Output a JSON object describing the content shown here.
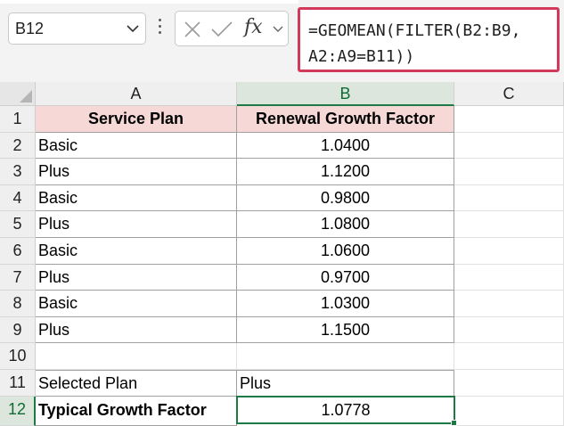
{
  "name_box": {
    "value": "B12",
    "dropdown_icon": "chevron-down-icon"
  },
  "formula_bar": {
    "cancel_icon": "close-icon",
    "enter_icon": "checkmark-icon",
    "function_label": "fx",
    "formula_line1": "=GEOMEAN(FILTER(B2:B9,",
    "formula_line2": "A2:A9=B11))",
    "highlight_color": "#d13a5a"
  },
  "columns": [
    "A",
    "B",
    "C"
  ],
  "rows": [
    "1",
    "2",
    "3",
    "4",
    "5",
    "6",
    "7",
    "8",
    "9",
    "10",
    "11",
    "12"
  ],
  "sheet": {
    "header": {
      "col_a": "Service Plan",
      "col_b": "Renewal Growth Factor",
      "fill": "#f6d9d7"
    },
    "data": [
      {
        "plan": "Basic",
        "factor": "1.0400"
      },
      {
        "plan": "Plus",
        "factor": "1.1200"
      },
      {
        "plan": "Basic",
        "factor": "0.9800"
      },
      {
        "plan": "Plus",
        "factor": "1.0800"
      },
      {
        "plan": "Basic",
        "factor": "1.0600"
      },
      {
        "plan": "Plus",
        "factor": "0.9700"
      },
      {
        "plan": "Basic",
        "factor": "1.0300"
      },
      {
        "plan": "Plus",
        "factor": "1.1500"
      }
    ],
    "selected_plan_label": "Selected Plan",
    "selected_plan_value": "Plus",
    "typical_label": "Typical Growth Factor",
    "typical_value": "1.0778"
  },
  "active_cell": "B12",
  "accent_color": "#1e7a45"
}
